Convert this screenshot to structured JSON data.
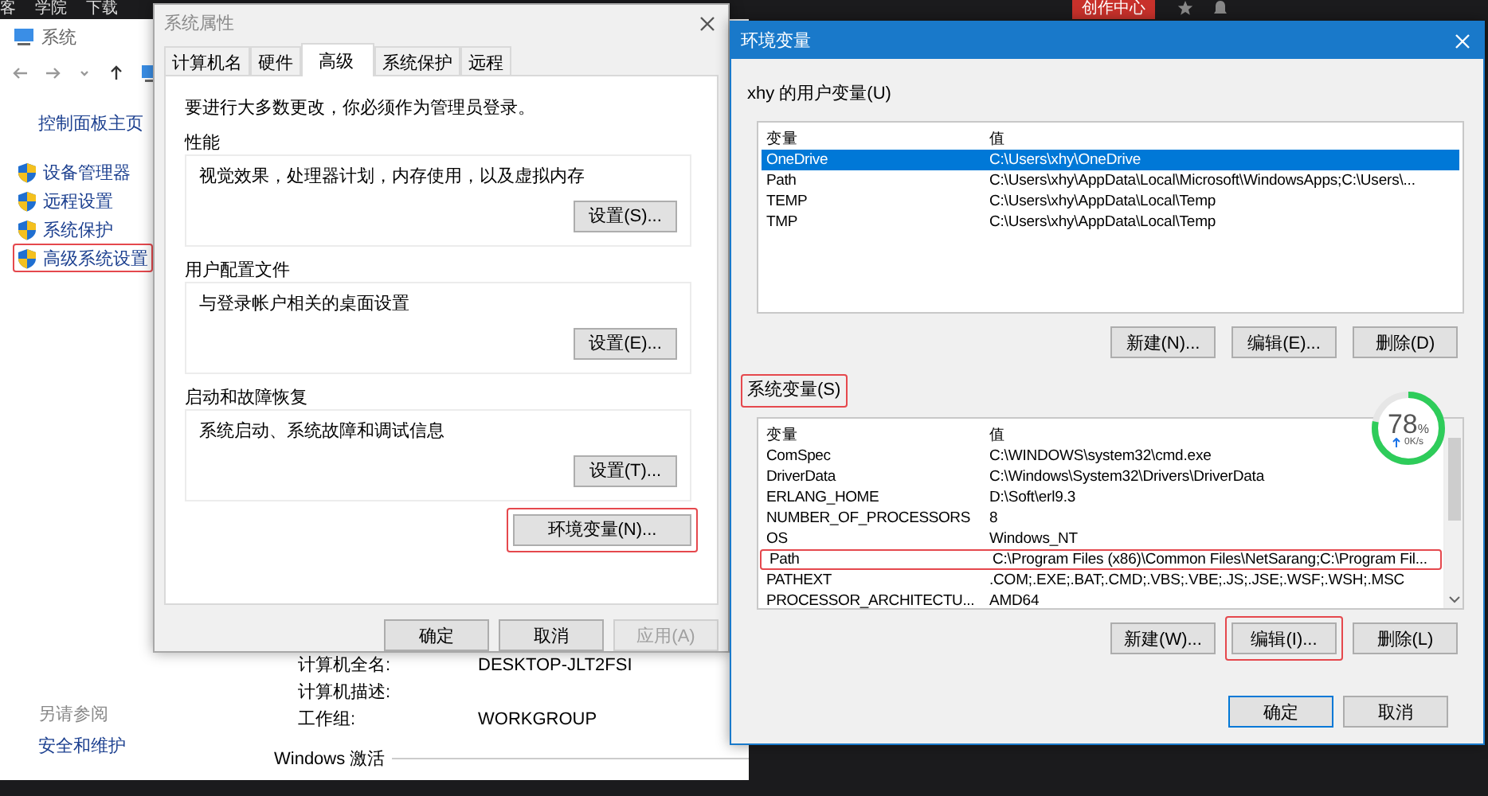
{
  "top_bar": {
    "links": [
      "客",
      "学院",
      "下载"
    ],
    "create_button": "创作中心"
  },
  "system_window": {
    "title": "系统",
    "sidebar": {
      "home": "控制面板主页",
      "items": [
        {
          "label": "设备管理器",
          "highlighted": false
        },
        {
          "label": "远程设置",
          "highlighted": false
        },
        {
          "label": "系统保护",
          "highlighted": false
        },
        {
          "label": "高级系统设置",
          "highlighted": true
        }
      ]
    },
    "see_also": {
      "heading": "另请参阅",
      "links": [
        "安全和维护"
      ]
    },
    "info_rows": [
      {
        "label": "计算机全名:",
        "value": "DESKTOP-JLT2FSI"
      },
      {
        "label": "计算机描述:"
      },
      {
        "label": "工作组:",
        "value": "WORKGROUP"
      }
    ],
    "activation": "Windows 激活"
  },
  "system_properties": {
    "title": "系统属性",
    "tabs": [
      {
        "label": "计算机名",
        "selected": false
      },
      {
        "label": "硬件",
        "selected": false
      },
      {
        "label": "高级",
        "selected": true
      },
      {
        "label": "系统保护",
        "selected": false
      },
      {
        "label": "远程",
        "selected": false
      }
    ],
    "notice": "要进行大多数更改，你必须作为管理员登录。",
    "groups": [
      {
        "title": "性能",
        "description": "视觉效果，处理器计划，内存使用，以及虚拟内存",
        "button": "设置(S)..."
      },
      {
        "title": "用户配置文件",
        "description": "与登录帐户相关的桌面设置",
        "button": "设置(E)..."
      },
      {
        "title": "启动和故障恢复",
        "description": "系统启动、系统故障和调试信息",
        "button": "设置(T)..."
      }
    ],
    "env_button": {
      "label": "环境变量(N)...",
      "highlighted": true
    },
    "buttons": [
      {
        "label": "确定",
        "disabled": false
      },
      {
        "label": "取消",
        "disabled": false
      },
      {
        "label": "应用(A)",
        "disabled": true
      }
    ]
  },
  "environment_variables": {
    "title": "环境变量",
    "user_vars": {
      "title": "xhy 的用户变量(U)",
      "highlighted": false,
      "columns": [
        "变量",
        "值"
      ],
      "rows": [
        {
          "name": "OneDrive",
          "value": "C:\\Users\\xhy\\OneDrive",
          "selected": true,
          "highlighted": false
        },
        {
          "name": "Path",
          "value": "C:\\Users\\xhy\\AppData\\Local\\Microsoft\\WindowsApps;C:\\Users\\...",
          "selected": false,
          "highlighted": false
        },
        {
          "name": "TEMP",
          "value": "C:\\Users\\xhy\\AppData\\Local\\Temp",
          "selected": false,
          "highlighted": false
        },
        {
          "name": "TMP",
          "value": "C:\\Users\\xhy\\AppData\\Local\\Temp",
          "selected": false,
          "highlighted": false
        }
      ],
      "buttons": [
        {
          "label": "新建(N)...",
          "highlighted": false
        },
        {
          "label": "编辑(E)...",
          "highlighted": false
        },
        {
          "label": "删除(D)",
          "highlighted": false
        }
      ]
    },
    "system_vars": {
      "title": "系统变量(S)",
      "highlighted": true,
      "columns": [
        "变量",
        "值"
      ],
      "rows": [
        {
          "name": "ComSpec",
          "value": "C:\\WINDOWS\\system32\\cmd.exe",
          "selected": false,
          "highlighted": false
        },
        {
          "name": "DriverData",
          "value": "C:\\Windows\\System32\\Drivers\\DriverData",
          "selected": false,
          "highlighted": false
        },
        {
          "name": "ERLANG_HOME",
          "value": "D:\\Soft\\erl9.3",
          "selected": false,
          "highlighted": false
        },
        {
          "name": "NUMBER_OF_PROCESSORS",
          "value": "8",
          "selected": false,
          "highlighted": false
        },
        {
          "name": "OS",
          "value": "Windows_NT",
          "selected": false,
          "highlighted": false
        },
        {
          "name": "Path",
          "value": "C:\\Program Files (x86)\\Common Files\\NetSarang;C:\\Program Fil...",
          "selected": false,
          "highlighted": true
        },
        {
          "name": "PATHEXT",
          "value": ".COM;.EXE;.BAT;.CMD;.VBS;.VBE;.JS;.JSE;.WSF;.WSH;.MSC",
          "selected": false,
          "highlighted": false
        },
        {
          "name": "PROCESSOR_ARCHITECTU...",
          "value": "AMD64",
          "selected": false,
          "highlighted": false
        }
      ],
      "buttons": [
        {
          "label": "新建(W)...",
          "highlighted": false
        },
        {
          "label": "编辑(I)...",
          "highlighted": true
        },
        {
          "label": "删除(L)",
          "highlighted": false
        }
      ]
    },
    "buttons": [
      {
        "label": "确定",
        "default": true
      },
      {
        "label": "取消",
        "default": false
      }
    ]
  },
  "speed_widget": {
    "percent": "78",
    "unit": "%",
    "rate": "0K/s",
    "level": 0.78
  }
}
